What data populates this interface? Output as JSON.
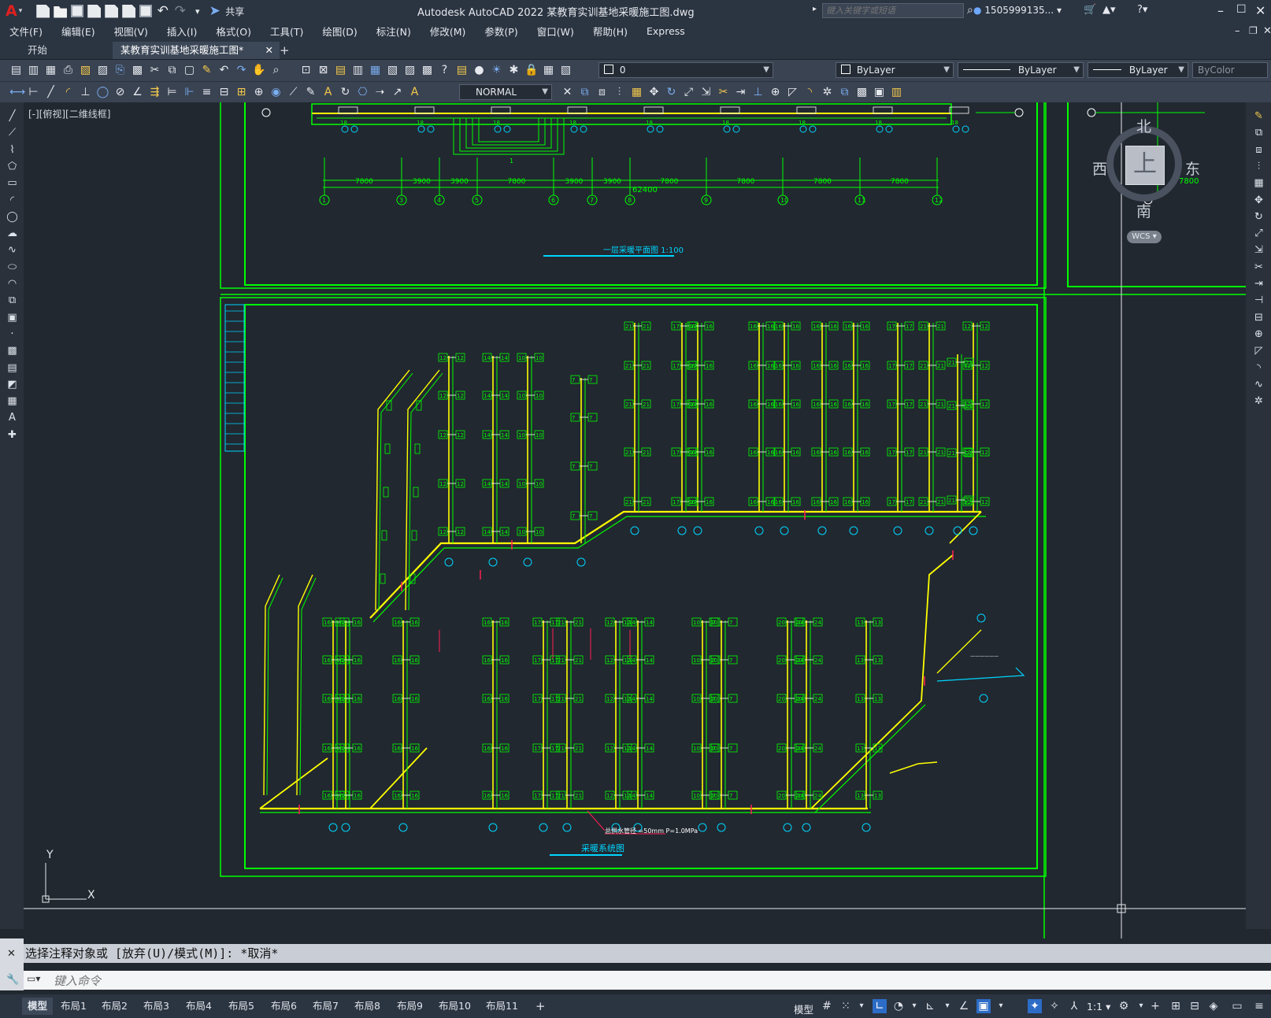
{
  "app": {
    "title": "Autodesk AutoCAD 2022    某教育实训基地采暖施工图.dwg",
    "search_placeholder": "键入关键字或短语",
    "user": "1505999135...",
    "share_label": "共享"
  },
  "menu": [
    "文件(F)",
    "编辑(E)",
    "视图(V)",
    "插入(I)",
    "格式(O)",
    "工具(T)",
    "绘图(D)",
    "标注(N)",
    "修改(M)",
    "参数(P)",
    "窗口(W)",
    "帮助(H)",
    "Express"
  ],
  "file_tabs": {
    "start": "开始",
    "active": "某教育实训基地采暖施工图*",
    "close": "✕",
    "add": "+"
  },
  "properties": {
    "layer": "0",
    "color": "ByLayer",
    "linetype": "ByLayer",
    "lineweight": "ByLayer",
    "plotstyle": "ByColor",
    "textstyle": "NORMAL"
  },
  "viewport_label": "[-][俯视][二维线框]",
  "viewcube": {
    "north": "北",
    "south": "南",
    "east": "东",
    "west": "西",
    "top": "上",
    "wcs": "WCS"
  },
  "drawing": {
    "plan_title": "一层采暖平面图  1:100",
    "system_title": "采暖系统图",
    "dims": [
      "7800",
      "3900",
      "3900",
      "7800",
      "3900",
      "3900",
      "7800",
      "7800",
      "7800",
      "7800"
    ],
    "total_dim": "62400",
    "axis_numbers": [
      "1",
      "3",
      "4",
      "5",
      "6",
      "7",
      "8",
      "9",
      "10",
      "11",
      "12"
    ],
    "axis_A": "A",
    "riser_values": [
      "21",
      "17",
      "16",
      "16",
      "16",
      "16",
      "16",
      "17",
      "21",
      "12",
      "14",
      "10",
      "7",
      "20",
      "24",
      "13",
      "8",
      "15"
    ],
    "pipe_note": "总供水管径 =50mm  P=1.0MPa",
    "right_dim": "7800"
  },
  "axes": {
    "x": "X",
    "y": "Y"
  },
  "command": {
    "history": "选择注释对象或 [放弃(U)/模式(M)]: *取消*",
    "placeholder": "键入命令"
  },
  "layouts": [
    "模型",
    "布局1",
    "布局2",
    "布局3",
    "布局4",
    "布局5",
    "布局6",
    "布局7",
    "布局8",
    "布局9",
    "布局10",
    "布局11"
  ],
  "status": {
    "model": "模型",
    "scale": "1:1"
  }
}
